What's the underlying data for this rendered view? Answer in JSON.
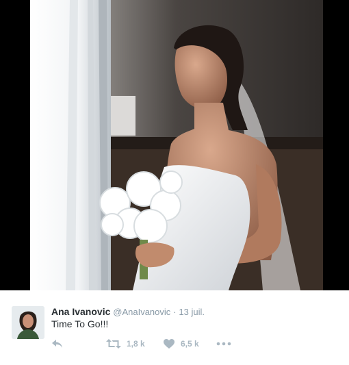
{
  "tweet": {
    "author_name": "Ana Ivanovic",
    "author_handle": "@AnaIvanovic",
    "separator": "·",
    "timestamp": "13 juil.",
    "text": "Time To Go!!!",
    "retweet_count": "1,8 k",
    "like_count": "6,5 k"
  },
  "icons": {
    "reply": "reply-icon",
    "retweet": "retweet-icon",
    "like": "heart-icon",
    "more": "more-dots-icon"
  },
  "colors": {
    "name_text": "#292f33",
    "meta_text": "#8899a6",
    "action_icon": "#aab8c2",
    "media_background": "#000000"
  }
}
